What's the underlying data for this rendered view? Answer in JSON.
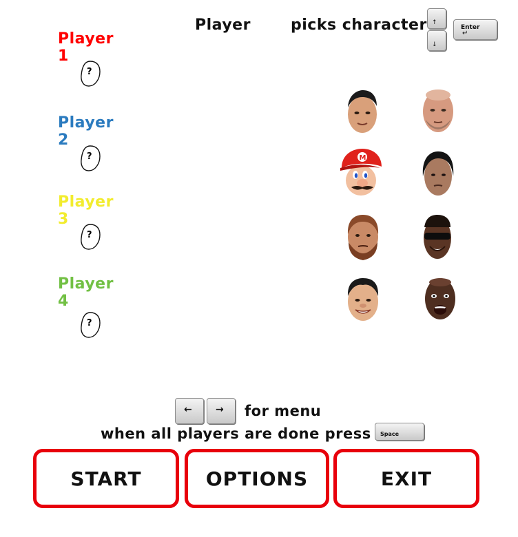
{
  "header": {
    "player_label": "Player",
    "picks_label": "picks character",
    "up_key_glyph": "↑",
    "down_key_glyph": "↓",
    "enter_key_label": "Enter"
  },
  "players": [
    {
      "label": "Player 1",
      "color": "#ff0000",
      "slot": "?"
    },
    {
      "label": "Player 2",
      "color": "#2b7bbf",
      "slot": "?"
    },
    {
      "label": "Player 3",
      "color": "#f2ec2e",
      "slot": "?"
    },
    {
      "label": "Player 4",
      "color": "#72c044",
      "slot": "?"
    }
  ],
  "characters": [
    {
      "icon": "face-jet-li-icon"
    },
    {
      "icon": "face-jason-statham-icon"
    },
    {
      "icon": "face-mario-icon"
    },
    {
      "icon": "face-steven-seagal-icon"
    },
    {
      "icon": "face-chuck-norris-icon"
    },
    {
      "icon": "face-wesley-snipes-icon"
    },
    {
      "icon": "face-jackie-chan-icon"
    },
    {
      "icon": "face-terry-crews-icon"
    }
  ],
  "instructions": {
    "left_key_glyph": "←",
    "right_key_glyph": "→",
    "menu_text": "for menu",
    "done_text": "when all players are done press",
    "space_key_label": "Space"
  },
  "buttons": {
    "start": "START",
    "options": "OPTIONS",
    "exit": "EXIT"
  },
  "colors": {
    "button_border": "#e8000b"
  }
}
